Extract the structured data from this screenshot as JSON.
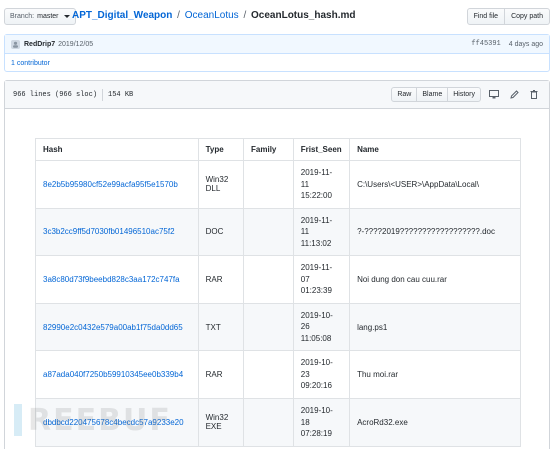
{
  "topbar": {
    "branch_label": "Branch:",
    "branch_name": "master",
    "repo": "APT_Digital_Weapon",
    "dir": "OceanLotus",
    "file": "OceanLotus_hash.md",
    "sep": "/",
    "find_file": "Find file",
    "copy_path": "Copy path"
  },
  "commit": {
    "author": "RedDrip7",
    "date": "2019/12/05",
    "sha": "ff45391",
    "ago": "4 days ago",
    "contributors": "1 contributor"
  },
  "file": {
    "lines": "966 lines (966 sloc)",
    "size": "154 KB",
    "raw": "Raw",
    "blame": "Blame",
    "history": "History",
    "icons": [
      "desktop-icon",
      "pencil-icon",
      "trash-icon"
    ]
  },
  "table": {
    "headers": [
      "Hash",
      "Type",
      "Family",
      "Frist_Seen",
      "Name"
    ],
    "rows": [
      {
        "hash": "8e2b5b95980cf52e99acfa95f5e1570b",
        "type": "Win32 DLL",
        "family": "",
        "seen": [
          "2019-11-",
          "11",
          "15:22:00"
        ],
        "name": "C:\\Users\\<USER>\\AppData\\Local\\"
      },
      {
        "hash": "3c3b2cc9ff5d7030fb01496510ac75f2",
        "type": "DOC",
        "family": "",
        "seen": [
          "2019-11-",
          "11",
          "11:13:02"
        ],
        "name": "?-????2019??????????????????.doc"
      },
      {
        "hash": "3a8c80d73f9beebd828c3aa172c747fa",
        "type": "RAR",
        "family": "",
        "seen": [
          "2019-11-",
          "07",
          "01:23:39"
        ],
        "name": "Noi dung don cau cuu.rar"
      },
      {
        "hash": "82990e2c0432e579a00ab1f75da0dd65",
        "type": "TXT",
        "family": "",
        "seen": [
          "2019-10-",
          "26",
          "11:05:08"
        ],
        "name": "lang.ps1"
      },
      {
        "hash": "a87ada040f7250b59910345ee0b339b4",
        "type": "RAR",
        "family": "",
        "seen": [
          "2019-10-",
          "23",
          "09:20:16"
        ],
        "name": "Thu moi.rar"
      },
      {
        "hash": "dbdbcd220475678c4becdc57a9233e20",
        "type": "Win32 EXE",
        "family": "",
        "seen": [
          "2019-10-",
          "18",
          "07:28:19"
        ],
        "name": "AcroRd32.exe"
      }
    ]
  },
  "watermark": "REEBUF"
}
